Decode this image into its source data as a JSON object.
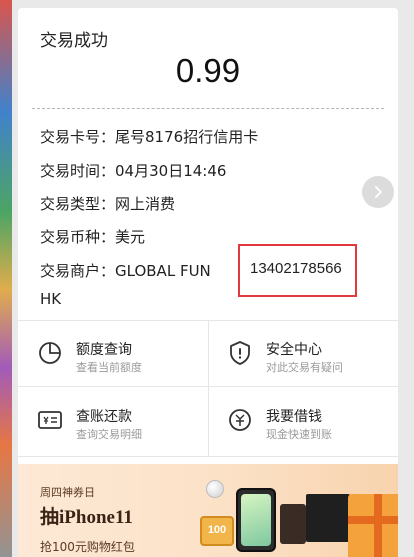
{
  "receipt": {
    "status": "交易成功",
    "amount": "0.99",
    "details": {
      "card": {
        "label": "交易卡号：",
        "value": "尾号8176招行信用卡"
      },
      "time": {
        "label": "交易时间：",
        "value": "04月30日14:46"
      },
      "type": {
        "label": "交易类型：",
        "value": "网上消费"
      },
      "currency": {
        "label": "交易币种：",
        "value": "美元"
      },
      "merchant": {
        "label": "交易商户：",
        "value_line1": "GLOBAL FUN",
        "value_line2": "HK"
      }
    },
    "annotation_phone": "13402178566"
  },
  "tiles": [
    {
      "title": "额度查询",
      "subtitle": "查看当前额度",
      "icon": "pie-chart-icon"
    },
    {
      "title": "安全中心",
      "subtitle": "对此交易有疑问",
      "icon": "shield-icon"
    },
    {
      "title": "查账还款",
      "subtitle": "查询交易明细",
      "icon": "bill-icon"
    },
    {
      "title": "我要借钱",
      "subtitle": "现金快速到账",
      "icon": "cash-icon"
    }
  ],
  "banner": {
    "tag": "周四神券日",
    "title": "抽iPhone11",
    "subtitle": "抢100元购物红包",
    "coin_label": "100"
  },
  "colors": {
    "annotation_red": "#e0393e",
    "banner_bg": "#fbe1c6"
  }
}
